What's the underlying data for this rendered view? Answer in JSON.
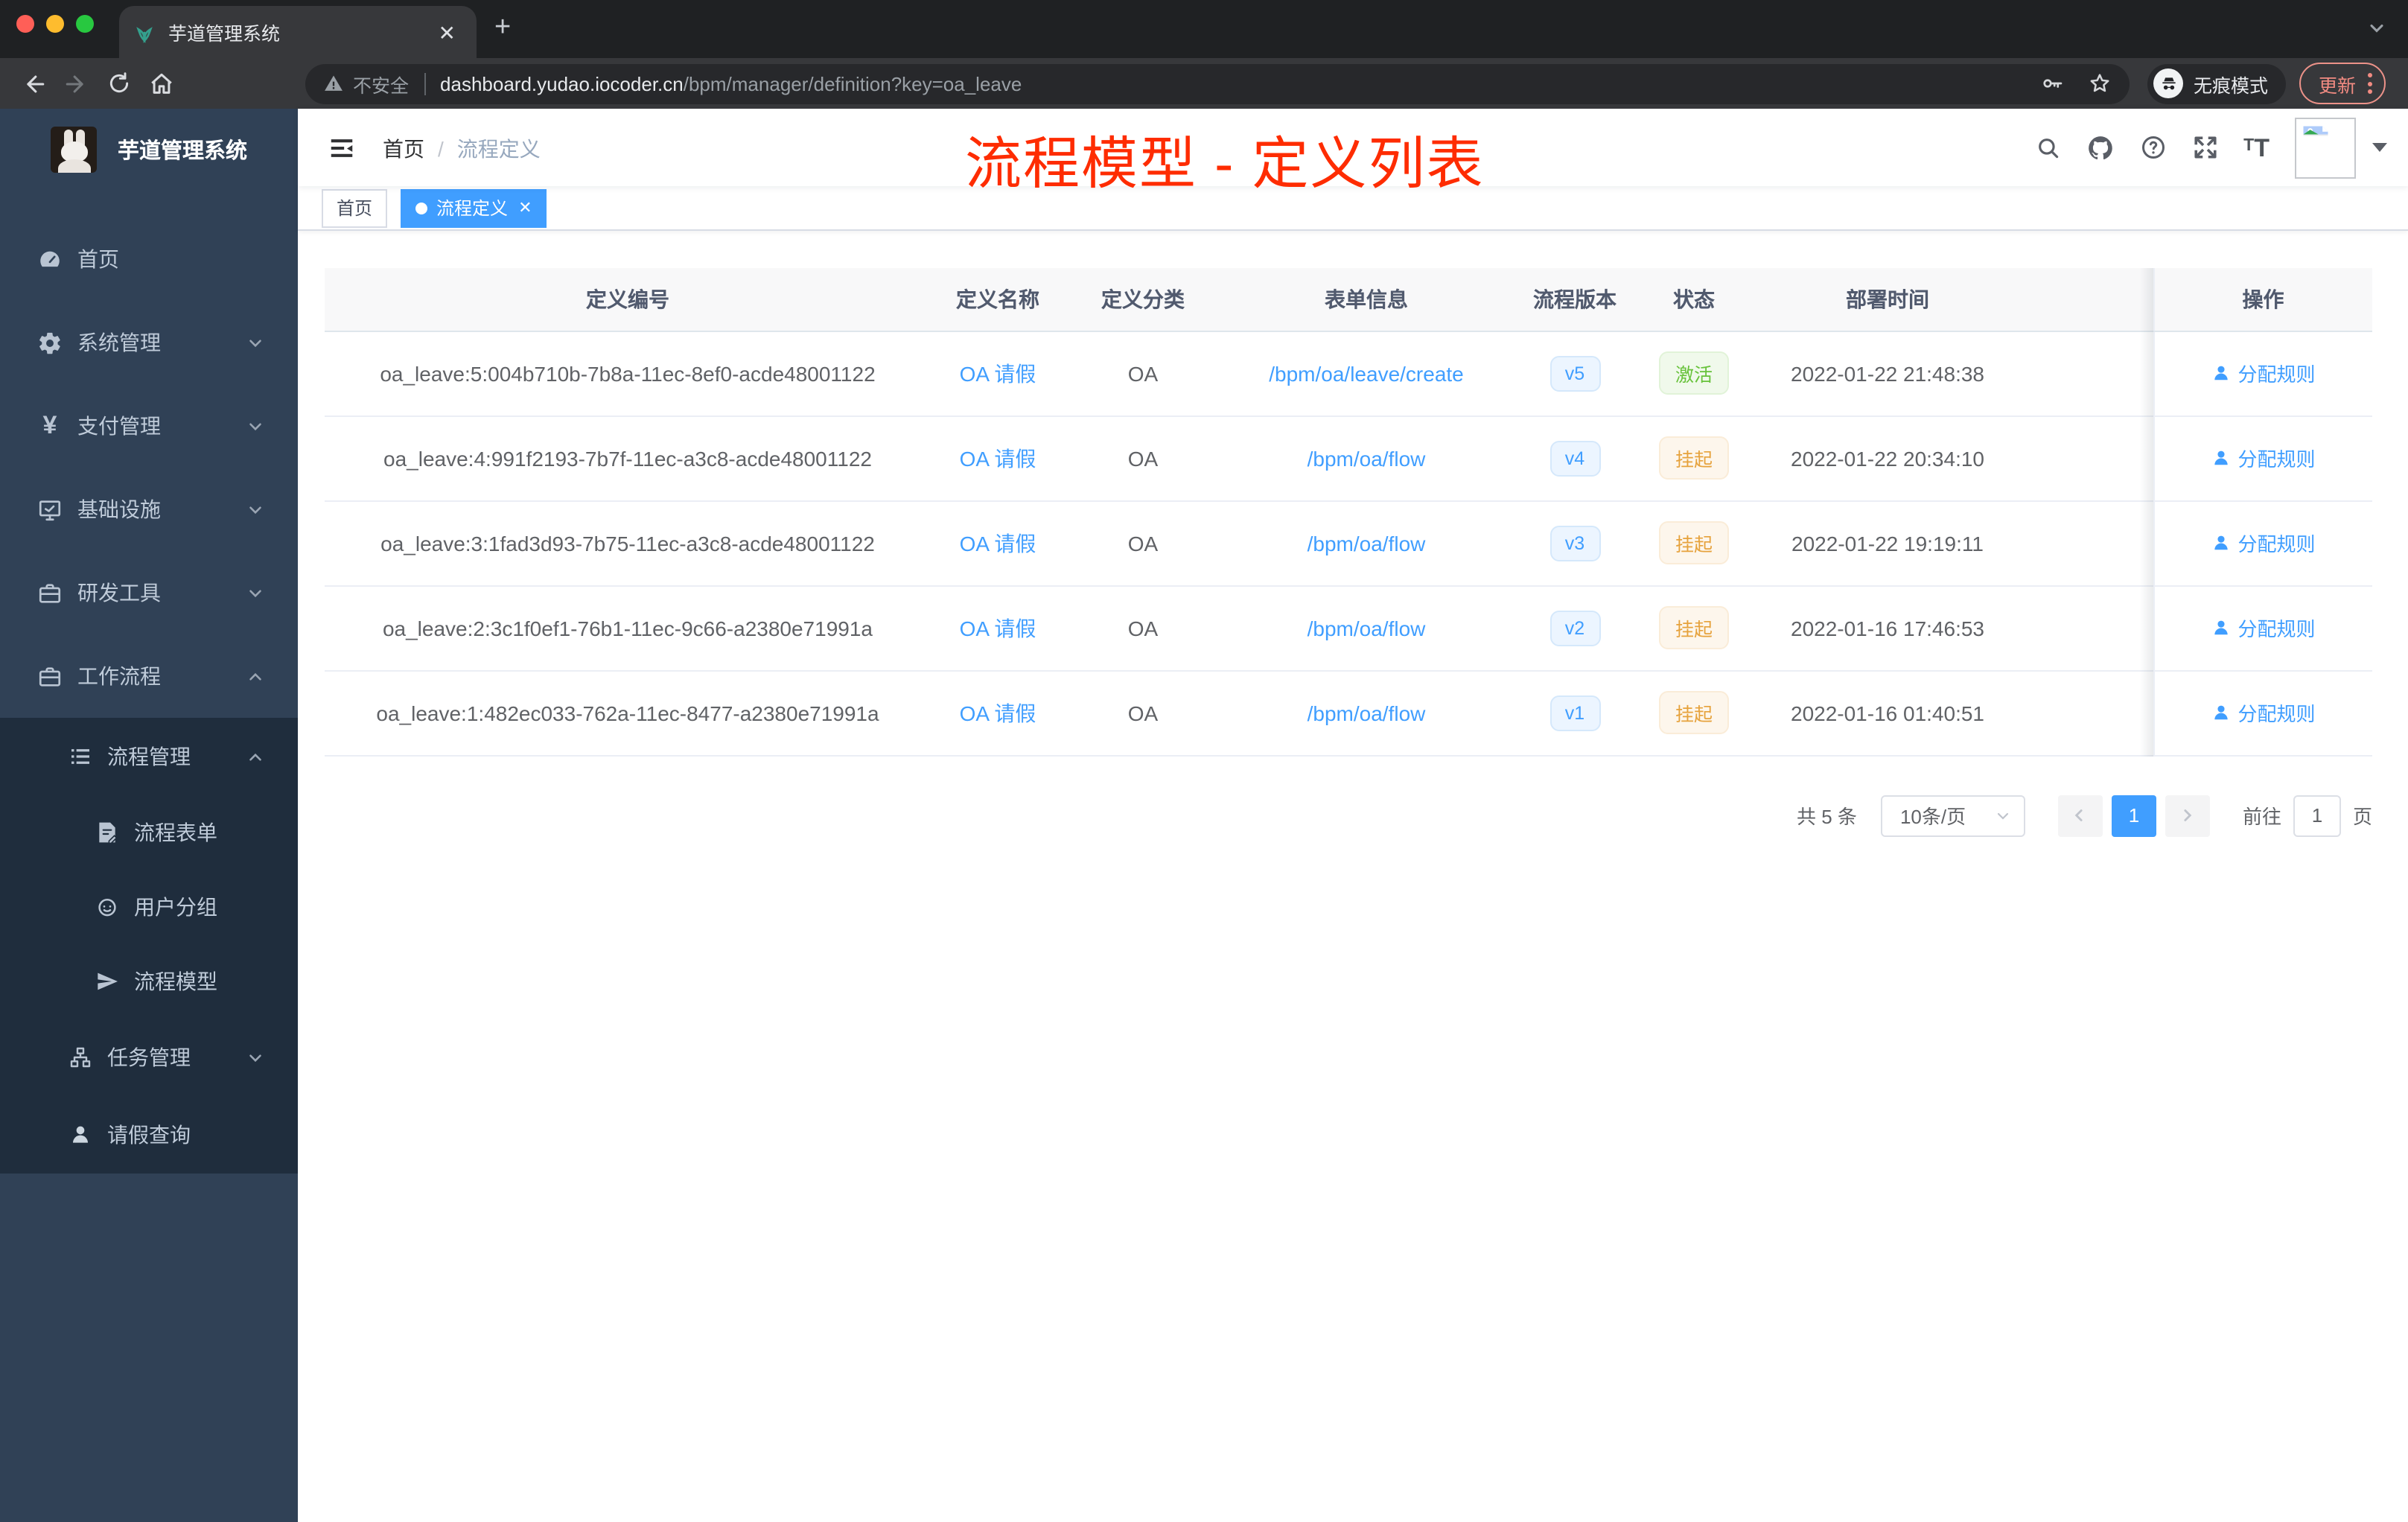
{
  "browser": {
    "tab_title": "芋道管理系统",
    "security_label": "不安全",
    "url_domain": "dashboard.yudao.iocoder.cn",
    "url_path": "/bpm/manager/definition?key=oa_leave",
    "incognito_label": "无痕模式",
    "update_label": "更新"
  },
  "sidebar": {
    "logo_title": "芋道管理系统",
    "items": [
      {
        "label": "首页"
      },
      {
        "label": "系统管理"
      },
      {
        "label": "支付管理"
      },
      {
        "label": "基础设施"
      },
      {
        "label": "研发工具"
      },
      {
        "label": "工作流程"
      }
    ],
    "submenu": [
      {
        "label": "流程管理"
      },
      {
        "label": "流程表单"
      },
      {
        "label": "用户分组"
      },
      {
        "label": "流程模型"
      },
      {
        "label": "任务管理"
      },
      {
        "label": "请假查询"
      }
    ]
  },
  "navbar": {
    "breadcrumb_home": "首页",
    "breadcrumb_separator": "/",
    "breadcrumb_current": "流程定义",
    "annotation": "流程模型 - 定义列表",
    "annotation_color": "#fe2c01"
  },
  "tags": {
    "home": "首页",
    "active": "流程定义"
  },
  "table": {
    "columns": [
      "定义编号",
      "定义名称",
      "定义分类",
      "表单信息",
      "流程版本",
      "状态",
      "部署时间",
      "操作"
    ],
    "rows": [
      {
        "id": "oa_leave:5:004b710b-7b8a-11ec-8ef0-acde48001122",
        "name": "OA 请假",
        "category": "OA",
        "form": "/bpm/oa/leave/create",
        "version": "v5",
        "status": "激活",
        "status_type": "success",
        "time": "2022-01-22 21:48:38",
        "action": "分配规则"
      },
      {
        "id": "oa_leave:4:991f2193-7b7f-11ec-a3c8-acde48001122",
        "name": "OA 请假",
        "category": "OA",
        "form": "/bpm/oa/flow",
        "version": "v4",
        "status": "挂起",
        "status_type": "warning",
        "time": "2022-01-22 20:34:10",
        "action": "分配规则"
      },
      {
        "id": "oa_leave:3:1fad3d93-7b75-11ec-a3c8-acde48001122",
        "name": "OA 请假",
        "category": "OA",
        "form": "/bpm/oa/flow",
        "version": "v3",
        "status": "挂起",
        "status_type": "warning",
        "time": "2022-01-22 19:19:11",
        "action": "分配规则"
      },
      {
        "id": "oa_leave:2:3c1f0ef1-76b1-11ec-9c66-a2380e71991a",
        "name": "OA 请假",
        "category": "OA",
        "form": "/bpm/oa/flow",
        "version": "v2",
        "status": "挂起",
        "status_type": "warning",
        "time": "2022-01-16 17:46:53",
        "action": "分配规则"
      },
      {
        "id": "oa_leave:1:482ec033-762a-11ec-8477-a2380e71991a",
        "name": "OA 请假",
        "category": "OA",
        "form": "/bpm/oa/flow",
        "version": "v1",
        "status": "挂起",
        "status_type": "warning",
        "time": "2022-01-16 01:40:51",
        "action": "分配规则"
      }
    ]
  },
  "pagination": {
    "total": "共 5 条",
    "page_size": "10条/页",
    "page": "1",
    "goto_label": "前往",
    "goto_value": "1",
    "page_unit": "页"
  },
  "colors": {
    "accent": "#409eff",
    "success": "#67c23a",
    "warning": "#e6a23c",
    "sidebar_bg": "#304156",
    "submenu_bg": "#1f2d3d",
    "annotation_red": "#fe2c01"
  }
}
